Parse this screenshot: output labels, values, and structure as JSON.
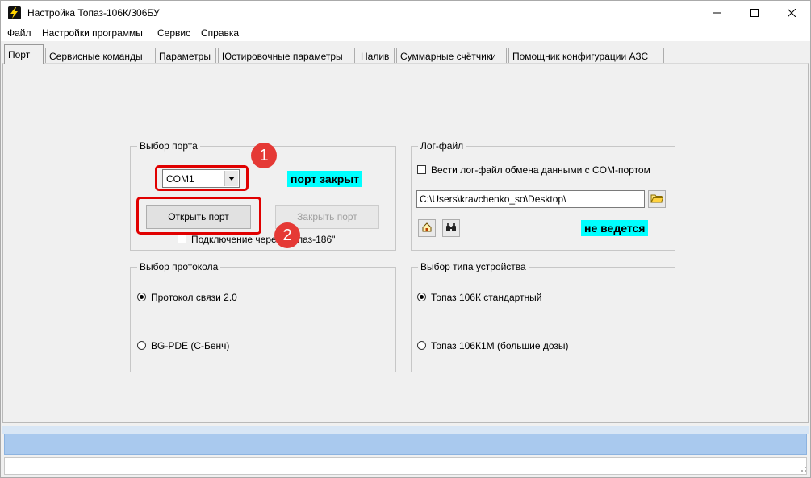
{
  "window": {
    "title": "Настройка Топаз-106К/306БУ"
  },
  "menu": [
    "Файл",
    "Настройки программы",
    "Сервис",
    "Справка"
  ],
  "tabs": [
    {
      "label": "Порт"
    },
    {
      "label": "Сервисные команды"
    },
    {
      "label": "Параметры"
    },
    {
      "label": "Юстировочные параметры"
    },
    {
      "label": "Налив"
    },
    {
      "label": "Суммарные счётчики"
    },
    {
      "label": "Помощник конфигурации АЗС"
    }
  ],
  "port_group": {
    "title": "Выбор порта",
    "selected_port": "COM1",
    "status": "порт закрыт",
    "open_button": "Открыть порт",
    "close_button": "Закрыть порт",
    "checkbox_label": "Подключение через \"Топаз-186\"",
    "checkbox_checked": false
  },
  "log_group": {
    "title": "Лог-файл",
    "checkbox_label": "Вести лог-файл обмена данными с COM-портом",
    "checkbox_checked": false,
    "path": "C:\\Users\\kravchenko_so\\Desktop\\",
    "status": "не ведется"
  },
  "protocol_group": {
    "title": "Выбор протокола",
    "options": [
      "Протокол связи 2.0",
      "BG-PDE (С-Бенч)"
    ],
    "selected_index": 0
  },
  "device_group": {
    "title": "Выбор типа устройства",
    "options": [
      "Топаз 106К стандартный",
      "Топаз 106К1М (большие дозы)"
    ],
    "selected_index": 0
  },
  "annotations": {
    "step1": "1",
    "step2": "2"
  },
  "colors": {
    "status_badge_bg": "#00ffff",
    "annotation_red": "#e00000",
    "progress_bar": "#a9c9ee"
  }
}
